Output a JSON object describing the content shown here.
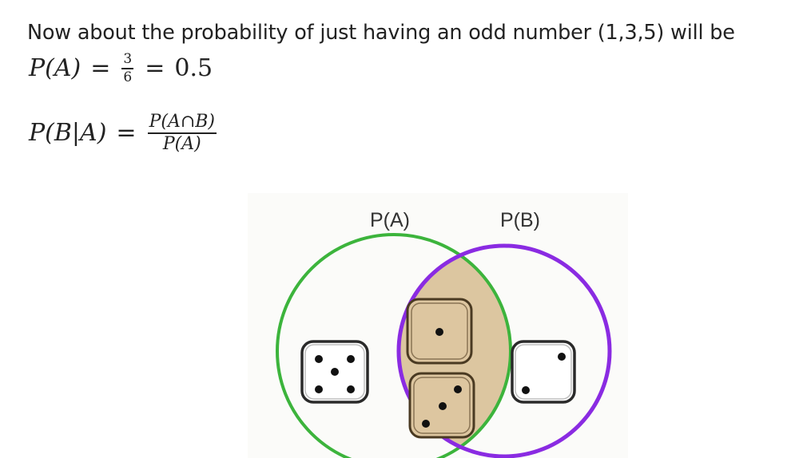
{
  "intro_text": "Now about the probability of just having an odd number (1,3,5) will be",
  "eq1": {
    "lhs": "P(A)",
    "equals": "=",
    "numerator": "3",
    "denominator": "6",
    "equals2": "=",
    "result": "0.5"
  },
  "eq2": {
    "lhs": "P(B|A)",
    "equals": "=",
    "numerator": "P(A∩B)",
    "denominator": "P(A)"
  },
  "venn": {
    "label_a": "P(A)",
    "label_b": "P(B)",
    "colors": {
      "circle_a": "#3cb43c",
      "circle_b": "#8a2be2",
      "overlap": "#dcc6a0",
      "die_face": "#ffffff",
      "die_overlap_face": "#ddc6a0",
      "pip": "#111111"
    },
    "dice": [
      {
        "name": "die-five",
        "value": 5
      },
      {
        "name": "die-one",
        "value": 1
      },
      {
        "name": "die-three",
        "value": 3
      },
      {
        "name": "die-two",
        "value": 2
      }
    ]
  }
}
